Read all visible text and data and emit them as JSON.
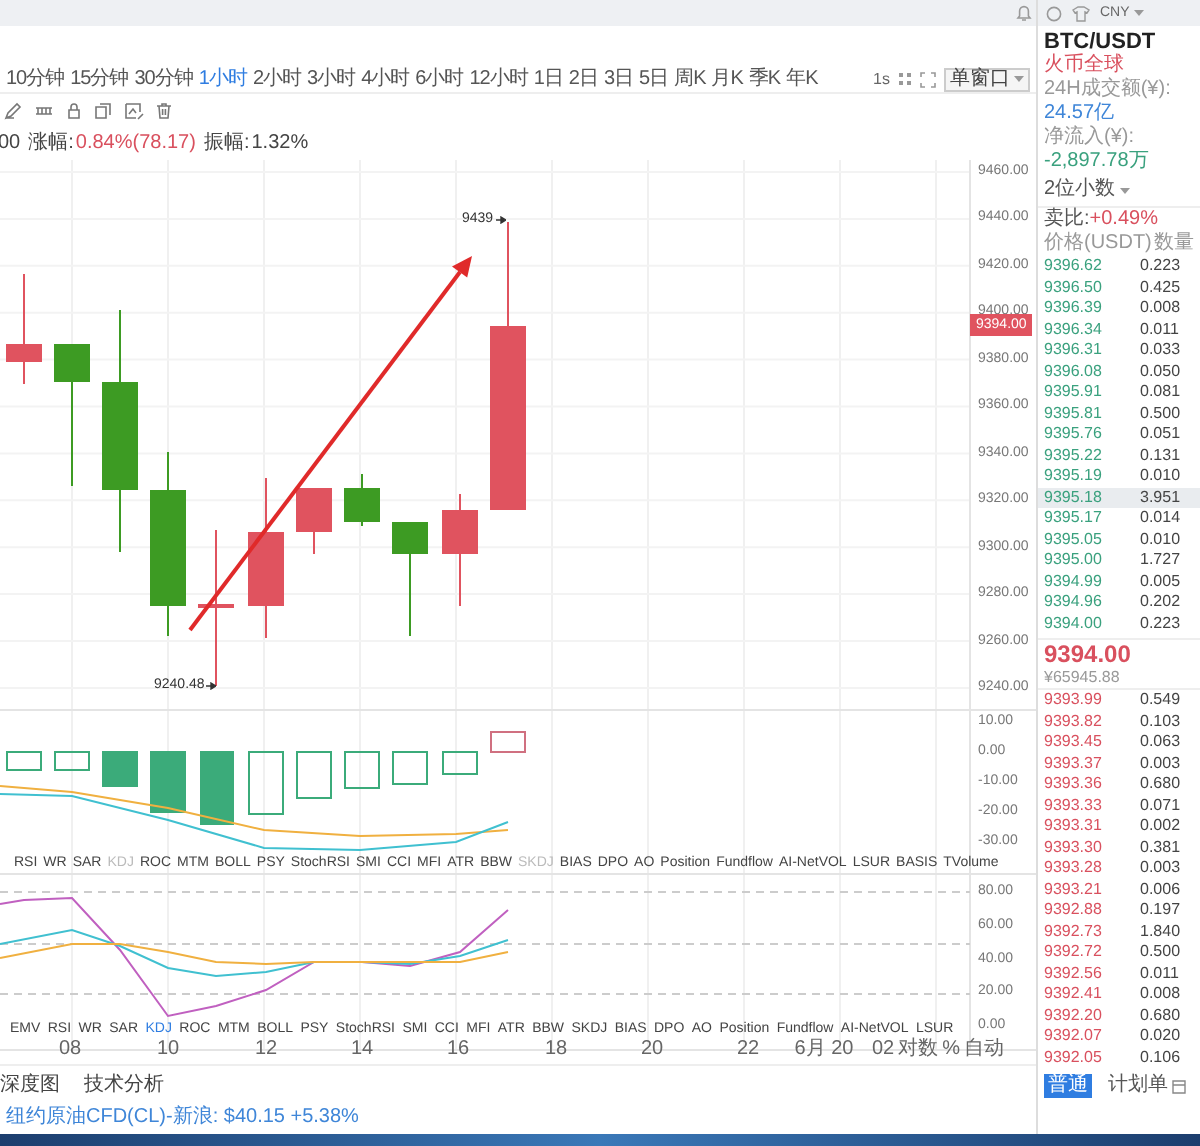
{
  "toolbar": {
    "timeframes": [
      {
        "label": "10分钟",
        "selected": false
      },
      {
        "label": "15分钟",
        "selected": false
      },
      {
        "label": "30分钟",
        "selected": false
      },
      {
        "label": "1小时",
        "selected": true
      },
      {
        "label": "2小时",
        "selected": false
      },
      {
        "label": "3小时",
        "selected": false
      },
      {
        "label": "4小时",
        "selected": false
      },
      {
        "label": "6小时",
        "selected": false
      },
      {
        "label": "12小时",
        "selected": false
      },
      {
        "label": "1日",
        "selected": false
      },
      {
        "label": "2日",
        "selected": false
      },
      {
        "label": "3日",
        "selected": false
      },
      {
        "label": "5日",
        "selected": false
      },
      {
        "label": "周K",
        "selected": false
      },
      {
        "label": "月K",
        "selected": false
      },
      {
        "label": "季K",
        "selected": false
      },
      {
        "label": "年K",
        "selected": false
      }
    ],
    "refresh": "1s",
    "layout": "单窗口"
  },
  "price_info": {
    "prefix": "00",
    "change_label": "涨幅:",
    "change": "0.84%(78.17)",
    "amplitude_label": "振幅:",
    "amplitude": "1.32%"
  },
  "main_chart": {
    "y_labels": [
      "9460.00",
      "9440.00",
      "9420.00",
      "9400.00",
      "9380.00",
      "9360.00",
      "9340.00",
      "9320.00",
      "9300.00",
      "9280.00",
      "9260.00",
      "9240.00"
    ],
    "current_price": "9394.00",
    "high_label": "9439",
    "low_label": "9240.48"
  },
  "indicator_1": {
    "y_labels": [
      "10.00",
      "0.00",
      "-10.00",
      "-20.00",
      "-30.00"
    ],
    "tabs": [
      {
        "label": "RSI",
        "disabled": false
      },
      {
        "label": "WR",
        "disabled": false
      },
      {
        "label": "SAR",
        "disabled": false
      },
      {
        "label": "KDJ",
        "disabled": true
      },
      {
        "label": "ROC",
        "disabled": false
      },
      {
        "label": "MTM",
        "disabled": false
      },
      {
        "label": "BOLL",
        "disabled": false
      },
      {
        "label": "PSY",
        "disabled": false
      },
      {
        "label": "StochRSI",
        "disabled": false
      },
      {
        "label": "SMI",
        "disabled": false
      },
      {
        "label": "CCI",
        "disabled": false
      },
      {
        "label": "MFI",
        "disabled": false
      },
      {
        "label": "ATR",
        "disabled": false
      },
      {
        "label": "BBW",
        "disabled": false
      },
      {
        "label": "SKDJ",
        "disabled": true
      },
      {
        "label": "BIAS",
        "disabled": false
      },
      {
        "label": "DPO",
        "disabled": false
      },
      {
        "label": "AO",
        "disabled": false
      },
      {
        "label": "Position",
        "disabled": false
      },
      {
        "label": "Fundflow",
        "disabled": false
      },
      {
        "label": "AI-NetVOL",
        "disabled": false
      },
      {
        "label": "LSUR",
        "disabled": false
      },
      {
        "label": "BASIS",
        "disabled": false
      },
      {
        "label": "TVolume",
        "disabled": false
      }
    ]
  },
  "indicator_2": {
    "y_labels": [
      "80.00",
      "60.00",
      "40.00",
      "20.00",
      "0.00"
    ],
    "tabs": [
      {
        "label": "EMV",
        "selected": false
      },
      {
        "label": "RSI",
        "selected": false
      },
      {
        "label": "WR",
        "selected": false
      },
      {
        "label": "SAR",
        "selected": false
      },
      {
        "label": "KDJ",
        "selected": true
      },
      {
        "label": "ROC",
        "selected": false
      },
      {
        "label": "MTM",
        "selected": false
      },
      {
        "label": "BOLL",
        "selected": false
      },
      {
        "label": "PSY",
        "selected": false
      },
      {
        "label": "StochRSI",
        "selected": false
      },
      {
        "label": "SMI",
        "selected": false
      },
      {
        "label": "CCI",
        "selected": false
      },
      {
        "label": "MFI",
        "selected": false
      },
      {
        "label": "ATR",
        "selected": false
      },
      {
        "label": "BBW",
        "selected": false
      },
      {
        "label": "SKDJ",
        "selected": false
      },
      {
        "label": "BIAS",
        "selected": false
      },
      {
        "label": "DPO",
        "selected": false
      },
      {
        "label": "AO",
        "selected": false
      },
      {
        "label": "Position",
        "selected": false
      },
      {
        "label": "Fundflow",
        "selected": false
      },
      {
        "label": "AI-NetVOL",
        "selected": false
      },
      {
        "label": "LSUR",
        "selected": false
      }
    ]
  },
  "x_axis": {
    "labels": [
      "08",
      "10",
      "12",
      "14",
      "16",
      "18",
      "20",
      "22",
      "6月 20"
    ],
    "controls": [
      "02",
      "对数",
      "%",
      "自动"
    ]
  },
  "bottom_tabs": [
    "深度图",
    "技术分析"
  ],
  "news_ticker": "纽约原油CFD(CL)-新浪: $40.15 +5.38%",
  "market": {
    "currency": "CNY",
    "pair": "BTC/USDT",
    "exchange": "火币全球",
    "volume_label": "24H成交额(¥):",
    "volume": "24.57亿",
    "inflow_label": "净流入(¥):",
    "inflow": "-2,897.78万",
    "decimals": "2位小数",
    "ratio_label": "卖比:",
    "ratio": "+0.49%",
    "price_header": "价格(USDT)",
    "qty_header": "数量"
  },
  "asks": [
    {
      "price": "9396.62",
      "qty": "0.223",
      "selected": false
    },
    {
      "price": "9396.50",
      "qty": "0.425",
      "selected": false
    },
    {
      "price": "9396.39",
      "qty": "0.008",
      "selected": false
    },
    {
      "price": "9396.34",
      "qty": "0.011",
      "selected": false
    },
    {
      "price": "9396.31",
      "qty": "0.033",
      "selected": false
    },
    {
      "price": "9396.08",
      "qty": "0.050",
      "selected": false
    },
    {
      "price": "9395.91",
      "qty": "0.081",
      "selected": false
    },
    {
      "price": "9395.81",
      "qty": "0.500",
      "selected": false
    },
    {
      "price": "9395.76",
      "qty": "0.051",
      "selected": false
    },
    {
      "price": "9395.22",
      "qty": "0.131",
      "selected": false
    },
    {
      "price": "9395.19",
      "qty": "0.010",
      "selected": false
    },
    {
      "price": "9395.18",
      "qty": "3.951",
      "selected": true
    },
    {
      "price": "9395.17",
      "qty": "0.014",
      "selected": false
    },
    {
      "price": "9395.05",
      "qty": "0.010",
      "selected": false
    },
    {
      "price": "9395.00",
      "qty": "1.727",
      "selected": false
    },
    {
      "price": "9394.99",
      "qty": "0.005",
      "selected": false
    },
    {
      "price": "9394.96",
      "qty": "0.202",
      "selected": false
    },
    {
      "price": "9394.00",
      "qty": "0.223",
      "selected": false
    }
  ],
  "last_price": "9394.00",
  "last_price_cny": "¥65945.88",
  "bids": [
    {
      "price": "9393.99",
      "qty": "0.549"
    },
    {
      "price": "9393.82",
      "qty": "0.103"
    },
    {
      "price": "9393.45",
      "qty": "0.063"
    },
    {
      "price": "9393.37",
      "qty": "0.003"
    },
    {
      "price": "9393.36",
      "qty": "0.680"
    },
    {
      "price": "9393.33",
      "qty": "0.071"
    },
    {
      "price": "9393.31",
      "qty": "0.002"
    },
    {
      "price": "9393.30",
      "qty": "0.381"
    },
    {
      "price": "9393.28",
      "qty": "0.003"
    },
    {
      "price": "9393.21",
      "qty": "0.006"
    },
    {
      "price": "9392.88",
      "qty": "0.197"
    },
    {
      "price": "9392.73",
      "qty": "1.840"
    },
    {
      "price": "9392.72",
      "qty": "0.500"
    },
    {
      "price": "9392.56",
      "qty": "0.011"
    },
    {
      "price": "9392.41",
      "qty": "0.008"
    },
    {
      "price": "9392.20",
      "qty": "0.680"
    },
    {
      "price": "9392.07",
      "qty": "0.020"
    },
    {
      "price": "9392.05",
      "qty": "0.106"
    }
  ],
  "order_tabs": [
    {
      "label": "普通",
      "selected": true
    },
    {
      "label": "计划单",
      "selected": false
    }
  ]
}
